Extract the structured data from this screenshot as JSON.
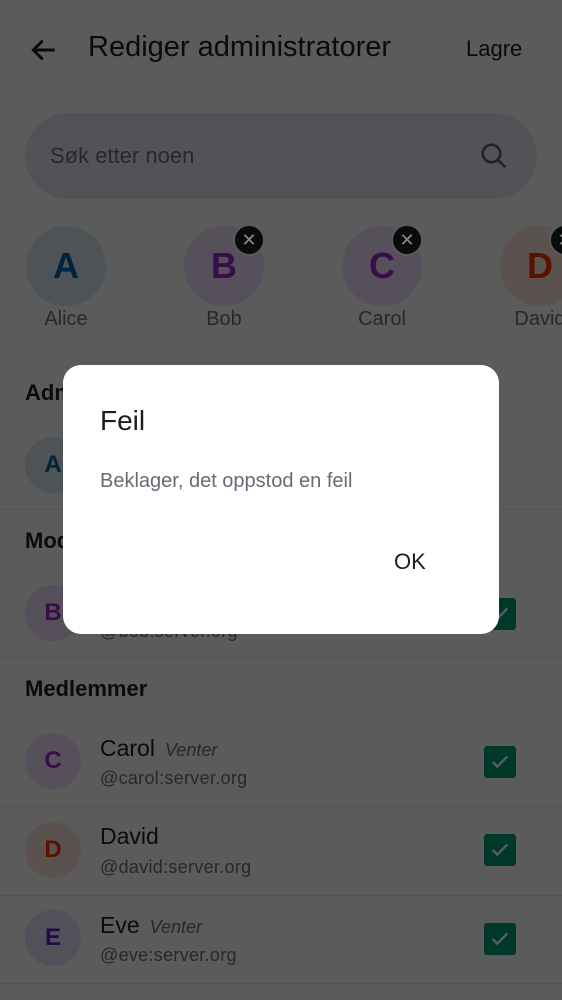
{
  "header": {
    "title": "Rediger administratorer",
    "save_label": "Lagre"
  },
  "search": {
    "placeholder": "Søk etter noen"
  },
  "selected": [
    {
      "initial": "A",
      "name": "Alice",
      "removable": false,
      "color": "#0b4a7a",
      "bg": "#d6e6f2"
    },
    {
      "initial": "B",
      "name": "Bob",
      "removable": true,
      "color": "#6b1a8a",
      "bg": "#ede0f0"
    },
    {
      "initial": "C",
      "name": "Carol",
      "removable": true,
      "color": "#6b1a8a",
      "bg": "#ede0f0"
    },
    {
      "initial": "D",
      "name": "David",
      "removable": true,
      "color": "#a12a0a",
      "bg": "#f7e3d9"
    }
  ],
  "sections": {
    "admins": "Administratorer",
    "moderators": "Moderatorer",
    "members": "Medlemmer"
  },
  "admins": [
    {
      "initial": "A"
    }
  ],
  "moderators": [
    {
      "initial": "B",
      "user_id": "@bob:server.org",
      "checked": true
    }
  ],
  "members": [
    {
      "initial": "C",
      "name": "Carol",
      "status": "Venter",
      "user_id": "@carol:server.org",
      "checked": true
    },
    {
      "initial": "D",
      "name": "David",
      "status": "",
      "user_id": "@david:server.org",
      "checked": true
    },
    {
      "initial": "E",
      "name": "Eve",
      "status": "Venter",
      "user_id": "@eve:server.org",
      "checked": true
    }
  ],
  "dialog": {
    "title": "Feil",
    "message": "Beklager, det oppstod en feil",
    "ok_label": "OK"
  }
}
